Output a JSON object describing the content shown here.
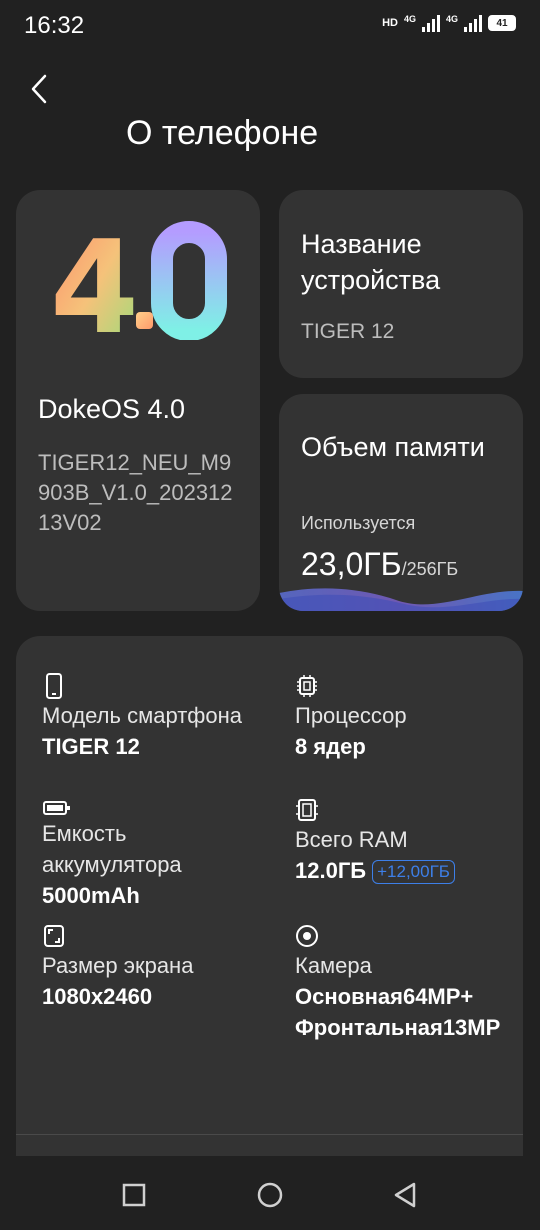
{
  "status": {
    "time": "16:32",
    "hd": "HD",
    "net1": "4G",
    "net2": "4G",
    "battery": "41"
  },
  "page": {
    "title": "О телефоне"
  },
  "os": {
    "logo_text": "4.0",
    "name": "DokeOS 4.0",
    "build": "TIGER12_NEU_M9903B_V1.0_20231213V02"
  },
  "device": {
    "title": "Название устройства",
    "name": "TIGER 12"
  },
  "memory": {
    "title": "Объем памяти",
    "label": "Используется",
    "used": "23,0ГБ",
    "total": "/256ГБ"
  },
  "specs": {
    "model": {
      "label": "Модель смартфона",
      "value": "TIGER 12",
      "icon": "phone-icon"
    },
    "cpu": {
      "label": "Процессор",
      "value": "8 ядер",
      "icon": "chip-icon"
    },
    "ram": {
      "label": "Всего RAM",
      "value": "12.0ГБ",
      "extra": "+12,00ГБ",
      "icon": "ram-icon"
    },
    "battery": {
      "label": "Емкость аккумулятора",
      "value": "5000mAh",
      "icon": "battery-icon"
    },
    "screen": {
      "label": "Размер экрана",
      "value": "1080x2460",
      "icon": "screen-icon"
    },
    "camera": {
      "label": "Камера",
      "value": "Основная64MP+ Фронтальная13MP",
      "icon": "camera-icon"
    }
  },
  "colors": {
    "background": "#212121",
    "card": "#333333",
    "accent": "#3d7fe8"
  }
}
